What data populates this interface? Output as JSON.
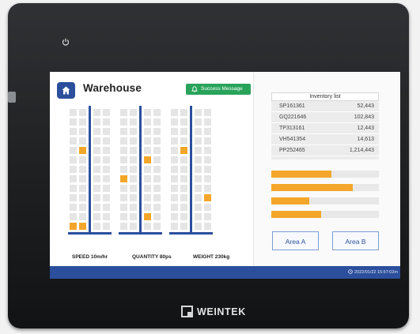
{
  "app": {
    "title": "Warehouse",
    "success_message": "Success Message",
    "brand": "WEINTEK"
  },
  "racks": [
    {
      "filled": [
        [
          4,
          1
        ],
        [
          12,
          0
        ],
        [
          12,
          1
        ]
      ]
    },
    {
      "filled": [
        [
          5,
          2
        ],
        [
          7,
          0
        ],
        [
          11,
          2
        ]
      ]
    },
    {
      "filled": [
        [
          4,
          1
        ],
        [
          9,
          3
        ]
      ]
    }
  ],
  "stats": {
    "speed": "SPEED  10m/hr",
    "quantity": "QUANTITY  80ps",
    "weight": "WEIGHT  230kg"
  },
  "inventory": {
    "header": "Inventory list",
    "rows": [
      {
        "code": "SP161361",
        "value": "52,443"
      },
      {
        "code": "GQ221646",
        "value": "102,843"
      },
      {
        "code": "TP313161",
        "value": "12,443"
      },
      {
        "code": "VH541354",
        "value": "14,613"
      },
      {
        "code": "PP252465",
        "value": "1,214,443"
      }
    ]
  },
  "progress": [
    0.56,
    0.76,
    0.35,
    0.46
  ],
  "buttons": {
    "area_a": "Area A",
    "area_b": "Area B"
  },
  "status": {
    "timestamp": "2022/01/22 15:57:02m"
  },
  "colors": {
    "accent": "#2b4f9c",
    "highlight": "#f4a62a",
    "success": "#29a35a"
  },
  "icons": [
    "power-icon",
    "home-icon",
    "bell-icon",
    "clock-icon",
    "weintek-logo-icon"
  ]
}
